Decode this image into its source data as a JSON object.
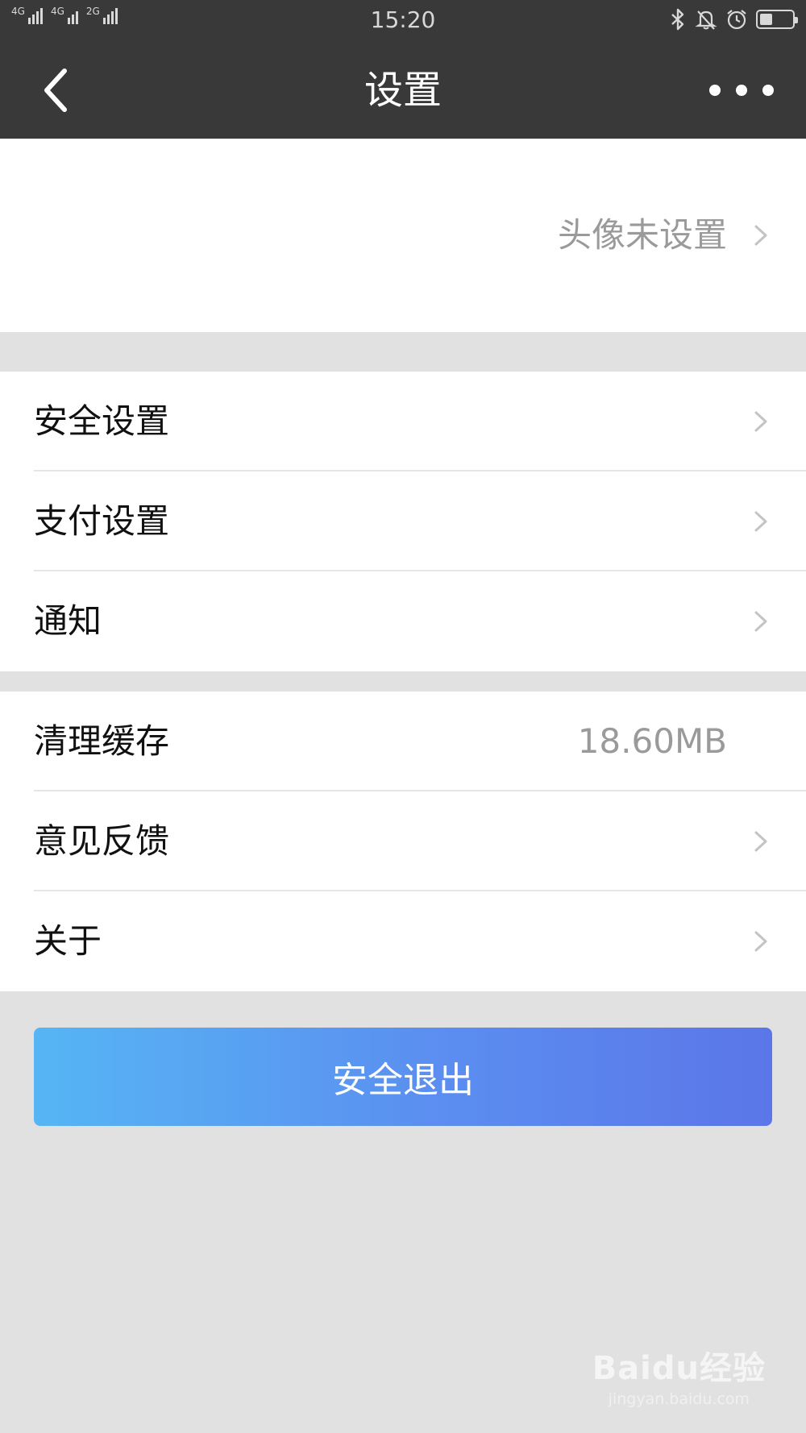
{
  "status_bar": {
    "network_1": "4G",
    "network_2": "4G",
    "network_3": "2G",
    "time": "15:20",
    "battery_level": 0.4,
    "icons": [
      "bluetooth-icon",
      "mute-bell-icon",
      "alarm-icon",
      "battery-icon"
    ]
  },
  "nav": {
    "title": "设置",
    "back_icon": "chevron-left-icon",
    "more_icon": "more-dots-icon"
  },
  "profile": {
    "avatar_status": "头像未设置"
  },
  "group1": {
    "items": [
      {
        "label": "安全设置"
      },
      {
        "label": "支付设置"
      },
      {
        "label": "通知"
      }
    ]
  },
  "group2": {
    "items": [
      {
        "label": "清理缓存",
        "value": "18.60MB"
      },
      {
        "label": "意见反馈"
      },
      {
        "label": "关于"
      }
    ]
  },
  "logout": {
    "label": "安全退出",
    "gradient_start": "#56b5f4",
    "gradient_end": "#5b76e8"
  },
  "watermark": {
    "logo_text": "Baidu经验",
    "url": "jingyan.baidu.com"
  }
}
